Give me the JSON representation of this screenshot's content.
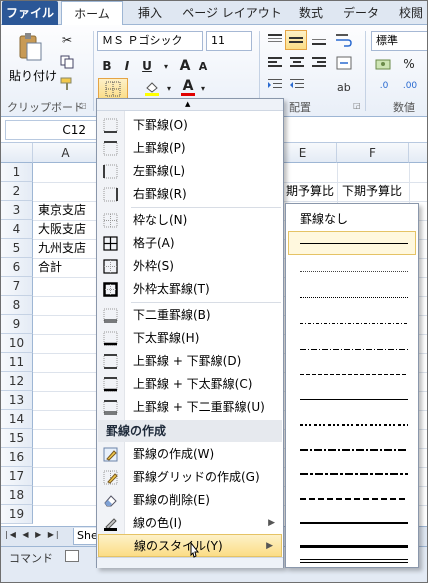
{
  "ribbon": {
    "tabs": [
      "ファイル",
      "ホーム",
      "挿入",
      "ページ レイアウト",
      "数式",
      "データ",
      "校閲"
    ],
    "paste_label": "貼り付け",
    "clipboard_group": "クリップボード",
    "font_name": "ＭＳ Ｐゴシック",
    "font_size": "11",
    "arrange_group": "配置",
    "number_format": "標準",
    "number_group": "数値"
  },
  "formula_bar": {
    "name_box": "C12"
  },
  "grid": {
    "columns": [
      "A",
      "E",
      "F"
    ],
    "rows": [
      "1",
      "2",
      "3",
      "4",
      "5",
      "6",
      "7",
      "8",
      "9",
      "10",
      "11",
      "12",
      "13",
      "14",
      "15",
      "16",
      "17",
      "18",
      "19"
    ],
    "cells": {
      "a3": "東京支店",
      "a4": "大阪支店",
      "a5": "九州支店",
      "a6": "合計",
      "e2": "期予算比",
      "f2": "下期予算比"
    }
  },
  "sheet_tab": "She",
  "status_label": "コマンド",
  "border_menu": {
    "items": [
      {
        "label": "下罫線(O)"
      },
      {
        "label": "上罫線(P)"
      },
      {
        "label": "左罫線(L)"
      },
      {
        "label": "右罫線(R)"
      },
      {
        "label": "枠なし(N)"
      },
      {
        "label": "格子(A)"
      },
      {
        "label": "外枠(S)"
      },
      {
        "label": "外枠太罫線(T)"
      },
      {
        "label": "下二重罫線(B)"
      },
      {
        "label": "下太罫線(H)"
      },
      {
        "label": "上罫線 + 下罫線(D)"
      },
      {
        "label": "上罫線 + 下太罫線(C)"
      },
      {
        "label": "上罫線 + 下二重罫線(U)"
      }
    ],
    "section_header": "罫線の作成",
    "draw_items": [
      {
        "label": "罫線の作成(W)"
      },
      {
        "label": "罫線グリッドの作成(G)"
      },
      {
        "label": "罫線の削除(E)"
      },
      {
        "label": "線の色(I)"
      },
      {
        "label": "線のスタイル(Y)"
      }
    ]
  },
  "line_style_menu": {
    "none_label": "罫線なし"
  }
}
